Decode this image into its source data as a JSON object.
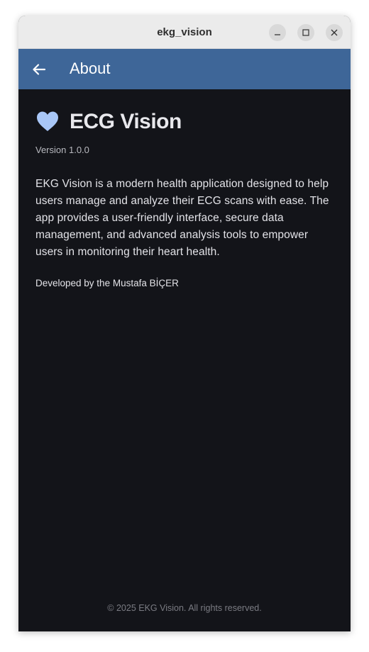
{
  "window": {
    "title": "ekg_vision",
    "controls": [
      "minimize-icon",
      "maximize-icon",
      "close-icon"
    ]
  },
  "appbar": {
    "back_icon": "arrow-left-icon",
    "title": "About"
  },
  "about": {
    "icon": "heart-icon",
    "app_name": "ECG Vision",
    "version": "Version 1.0.0",
    "description": "EKG Vision is a modern health application designed to help users manage and analyze their ECG scans with ease. The app provides a user-friendly interface, secure data management, and advanced analysis tools to empower users in monitoring their heart health.",
    "developer": "Developed by the Mustafa BİÇER"
  },
  "footer": {
    "copyright": "© 2025 EKG Vision. All rights reserved."
  },
  "colors": {
    "appbar": "#3e6698",
    "background": "#131419",
    "heart": "#a9c7f7",
    "titlebar": "#ebebeb"
  }
}
